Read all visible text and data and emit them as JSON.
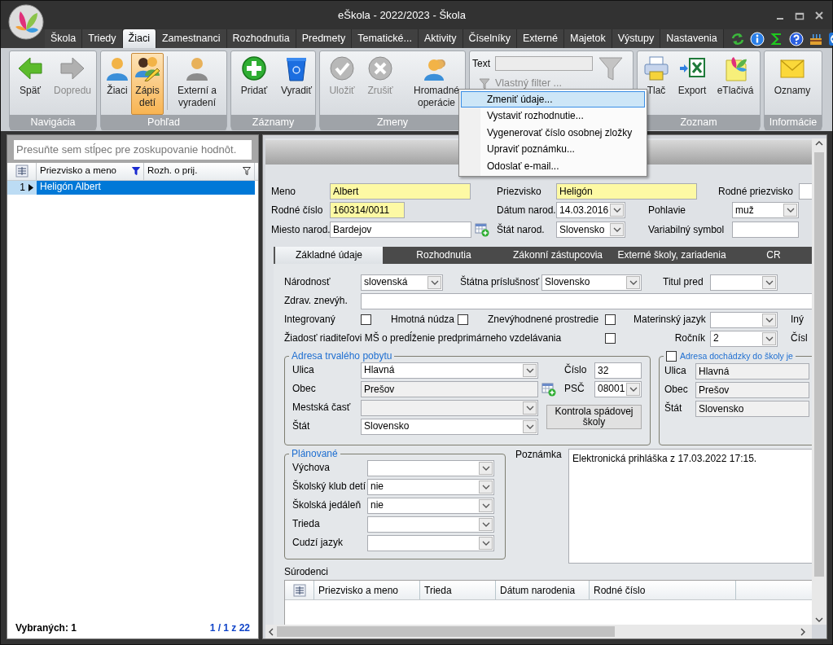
{
  "window": {
    "title": "eŠkola - 2022/2023 - Škola"
  },
  "menu_tabs": [
    {
      "label": "Škola",
      "selected": false
    },
    {
      "label": "Triedy",
      "selected": false
    },
    {
      "label": "Žiaci",
      "selected": true
    },
    {
      "label": "Zamestnanci",
      "selected": false
    },
    {
      "label": "Rozhodnutia",
      "selected": false
    },
    {
      "label": "Predmety",
      "selected": false
    },
    {
      "label": "Tematické...",
      "selected": false
    },
    {
      "label": "Aktivity",
      "selected": false
    },
    {
      "label": "Číselníky",
      "selected": false
    },
    {
      "label": "Externé",
      "selected": false
    },
    {
      "label": "Majetok",
      "selected": false
    },
    {
      "label": "Výstupy",
      "selected": false
    },
    {
      "label": "Nastavenia",
      "selected": false
    }
  ],
  "ribbon": [
    {
      "kind": "buttons",
      "label": "Navigácia",
      "buttons": [
        {
          "label": "Späť",
          "disabled": false,
          "selected": false
        },
        {
          "label": "Dopredu",
          "disabled": true,
          "selected": false
        }
      ]
    },
    {
      "kind": "buttons",
      "label": "Pohľad",
      "buttons": [
        {
          "label": "Žiaci",
          "disabled": false,
          "selected": false
        },
        {
          "label": "Zápis detí",
          "disabled": false,
          "selected": true
        },
        {
          "label": "Externí a vyradení",
          "disabled": false,
          "selected": false
        }
      ]
    },
    {
      "kind": "buttons",
      "label": "Záznamy",
      "buttons": [
        {
          "label": "Pridať",
          "disabled": false,
          "selected": false
        },
        {
          "label": "Vyradiť",
          "disabled": false,
          "selected": false
        }
      ]
    },
    {
      "kind": "buttons",
      "label": "Zmeny",
      "buttons": [
        {
          "label": "Uložiť",
          "disabled": true,
          "selected": false
        },
        {
          "label": "Zrušiť",
          "disabled": true,
          "selected": false
        },
        {
          "label": "Hromadné operácie",
          "disabled": false,
          "selected": false
        }
      ]
    },
    {
      "kind": "filter",
      "text_label": "Text",
      "custom_filter": "Vlastný filter ..."
    },
    {
      "kind": "buttons",
      "label": "Zoznam",
      "buttons": [
        {
          "label": "Tlač",
          "disabled": false,
          "selected": false
        },
        {
          "label": "Export",
          "disabled": false,
          "selected": false
        },
        {
          "label": "eTlačivá",
          "disabled": false,
          "selected": false
        }
      ]
    },
    {
      "kind": "buttons",
      "label": "Informácie",
      "buttons": [
        {
          "label": "Oznamy",
          "disabled": false,
          "selected": false
        }
      ]
    }
  ],
  "context_menu": [
    {
      "label": "Zmeniť údaje...",
      "selected": true
    },
    {
      "label": "Vystaviť rozhodnutie...",
      "selected": false
    },
    {
      "label": "Vygenerovať číslo osobnej zložky",
      "selected": false
    },
    {
      "label": "Upraviť poznámku...",
      "selected": false
    },
    {
      "label": "Odoslať e-mail...",
      "selected": false
    }
  ],
  "student_list": {
    "group_hint": "Presuňte sem stĺpec pre zoskupovanie hodnôt.",
    "columns": [
      {
        "label": "Priezvisko a meno",
        "filtered": true
      },
      {
        "label": "Rozh. o prij.",
        "filtered": false
      }
    ],
    "rows": [
      {
        "number": "1",
        "name": "Heligón Albert",
        "selected": true
      }
    ],
    "selected_count": "Vybraných: 1",
    "pager": "1 / 1 z 22"
  },
  "personal_rows": [
    [
      {
        "kind": "label",
        "text": "Meno"
      },
      {
        "kind": "text",
        "value": "Albert",
        "required": true
      },
      {
        "kind": "label",
        "text": "Priezvisko"
      },
      {
        "kind": "text",
        "value": "Heligón",
        "required": true
      },
      {
        "kind": "label",
        "text": "Rodné priezvisko"
      },
      {
        "kind": "text",
        "required": false
      }
    ],
    [
      {
        "kind": "label",
        "text": "Rodné číslo"
      },
      {
        "kind": "text",
        "value": "160314/0011",
        "required": true
      },
      {
        "kind": "label",
        "text": "Dátum narod."
      },
      {
        "kind": "combo",
        "value": "14.03.2016"
      },
      {
        "kind": "label",
        "text": "Pohlavie"
      },
      {
        "kind": "combo",
        "value": "muž"
      }
    ],
    [
      {
        "kind": "label",
        "text": "Miesto narod."
      },
      {
        "kind": "lookup",
        "value": "Bardejov",
        "readonly": false
      },
      {
        "kind": "label",
        "text": "Štát narod."
      },
      {
        "kind": "combo",
        "value": "Slovensko"
      },
      {
        "kind": "label",
        "text": "Variabilný symbol"
      },
      {
        "kind": "text",
        "required": false
      }
    ]
  ],
  "detail_tabs": [
    {
      "label": "Základné údaje",
      "selected": true
    },
    {
      "label": "Rozhodnutia",
      "selected": false
    },
    {
      "label": "Zákonní zástupcovia",
      "selected": false
    },
    {
      "label": "Externé školy, zariadenia",
      "selected": false
    },
    {
      "label": "CR",
      "selected": false
    }
  ],
  "basic_rows": [
    [
      {
        "kind": "label",
        "text": "Národnosť"
      },
      {
        "kind": "combo",
        "value": "slovenská"
      },
      {
        "kind": "label",
        "text": "Štátna príslušnosť"
      },
      {
        "kind": "combo",
        "value": "Slovensko"
      },
      {
        "kind": "label",
        "text": "Titul pred"
      },
      {
        "kind": "combo"
      }
    ],
    [
      {
        "kind": "label",
        "text": "Zdrav. znevýh."
      },
      {
        "kind": "text",
        "required": false
      }
    ],
    [
      {
        "kind": "label",
        "text": "Integrovaný"
      },
      {
        "kind": "checkbox",
        "checked": false
      },
      {
        "kind": "label",
        "text": "Hmotná núdza"
      },
      {
        "kind": "checkbox",
        "checked": false
      },
      {
        "kind": "label",
        "text": "Znevýhodnené prostredie"
      },
      {
        "kind": "checkbox",
        "checked": false
      },
      {
        "kind": "label",
        "text": "Materinský jazyk"
      },
      {
        "kind": "combo"
      },
      {
        "kind": "label",
        "text": "Iný"
      }
    ],
    [
      {
        "kind": "label",
        "text": "Žiadosť riaditeľovi MŠ o predĺženie predprimárneho vzdelávania"
      },
      {
        "kind": "checkbox",
        "checked": false
      },
      {
        "kind": "label",
        "text": "Ročník"
      },
      {
        "kind": "combo",
        "value": "2"
      },
      {
        "kind": "label",
        "text": "Čísl"
      }
    ]
  ],
  "permanent_address": {
    "title": "Adresa trvalého pobytu",
    "rows": [
      [
        {
          "kind": "label",
          "text": "Ulica"
        },
        {
          "kind": "combo",
          "value": "Hlavná",
          "disabled": false
        },
        {
          "kind": "label",
          "text": "Číslo"
        },
        {
          "kind": "text",
          "value": "32",
          "readonly": false
        }
      ],
      [
        {
          "kind": "label",
          "text": "Obec"
        },
        {
          "kind": "lookup",
          "value": "Prešov",
          "readonly": true
        },
        {
          "kind": "label",
          "text": "PSČ"
        },
        {
          "kind": "combo",
          "value": "08001",
          "disabled": false
        }
      ],
      [
        {
          "kind": "label",
          "text": "Mestská časť"
        },
        {
          "kind": "combo",
          "disabled": true
        }
      ],
      [
        {
          "kind": "label",
          "text": "Štát"
        },
        {
          "kind": "combo",
          "value": "Slovensko",
          "disabled": false
        }
      ]
    ],
    "button": "Kontrola spádovej školy"
  },
  "school_address": {
    "title": "Adresa dochádzky do školy je",
    "checked": false,
    "rows": [
      [
        {
          "kind": "label",
          "text": "Ulica"
        },
        {
          "kind": "text",
          "value": "Hlavná",
          "readonly": true
        }
      ],
      [
        {
          "kind": "label",
          "text": "Obec"
        },
        {
          "kind": "text",
          "value": "Prešov",
          "readonly": true
        }
      ],
      [
        {
          "kind": "label",
          "text": "Štát"
        },
        {
          "kind": "text",
          "value": "Slovensko",
          "readonly": true
        }
      ]
    ]
  },
  "planned": {
    "title": "Plánované",
    "rows": [
      {
        "label": "Výchova"
      },
      {
        "label": "Školský klub detí",
        "value": "nie"
      },
      {
        "label": "Školská jedáleň",
        "value": "nie"
      },
      {
        "label": "Trieda"
      },
      {
        "label": "Cudzí jazyk"
      }
    ]
  },
  "note": {
    "label": "Poznámka",
    "value": "Elektronická prihláška z 17.03.2022 17:15."
  },
  "siblings": {
    "label": "Súrodenci",
    "columns": [
      "Priezvisko a meno",
      "Trieda",
      "Dátum narodenia",
      "Rodné číslo"
    ]
  }
}
